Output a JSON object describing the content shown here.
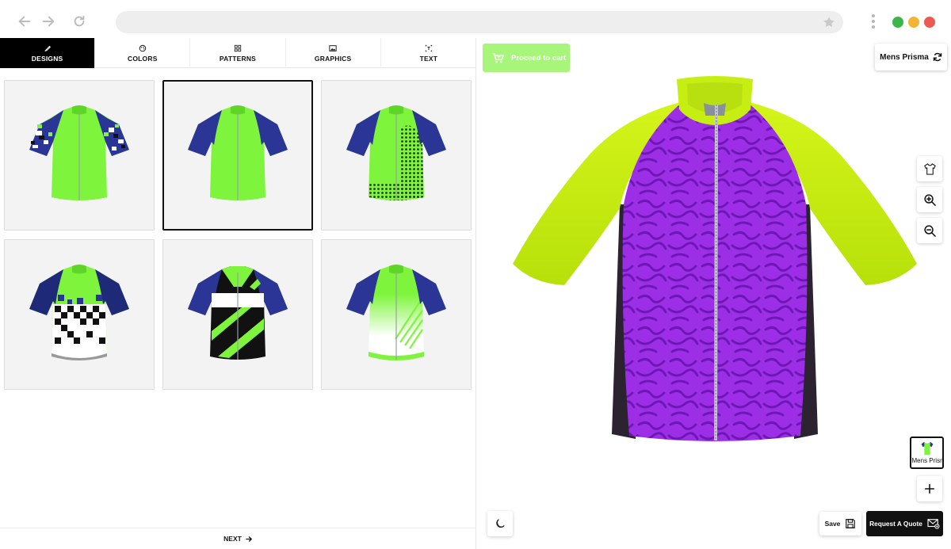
{
  "browser": {
    "icons": [
      "back-arrow-icon",
      "forward-arrow-icon",
      "reload-icon",
      "star-icon",
      "more-vertical-icon"
    ],
    "window_dot_colors": [
      "#3cb54a",
      "#f2b632",
      "#ee5a52"
    ]
  },
  "tabs": [
    {
      "label": "DESIGNS",
      "icon": "brush-icon",
      "active": true
    },
    {
      "label": "COLORS",
      "icon": "palette-icon",
      "active": false
    },
    {
      "label": "PATTERNS",
      "icon": "grid-icon",
      "active": false
    },
    {
      "label": "GRAPHICS",
      "icon": "image-icon",
      "active": false
    },
    {
      "label": "TEXT",
      "icon": "text-icon",
      "active": false
    }
  ],
  "designs": [
    {
      "style": "camo-sleeves",
      "selected": false
    },
    {
      "style": "plain-raglan",
      "selected": true
    },
    {
      "style": "halftone-side",
      "selected": false
    },
    {
      "style": "pixel-fade",
      "selected": false
    },
    {
      "style": "diagonal-stripes",
      "selected": false
    },
    {
      "style": "diagonal-fade",
      "selected": false
    }
  ],
  "next": {
    "label": "NEXT",
    "icon": "arrow-right-icon"
  },
  "actions": {
    "proceed_label": "Proceed to cart",
    "model_label": "Mens Prisma",
    "save_label": "Save",
    "quote_label": "Request A Quote",
    "thumbnail_label": "Mens Prisma"
  },
  "side_tools": [
    "shirt-icon",
    "zoom-in-icon",
    "zoom-out-icon"
  ],
  "colors": {
    "accent_green": "#a8f57c",
    "jersey_lime": "#7ef53c",
    "jersey_navy": "#2a3596",
    "preview_body": "#9c2fe6",
    "preview_sleeves": "#c6ee12",
    "dark": "#111111"
  }
}
